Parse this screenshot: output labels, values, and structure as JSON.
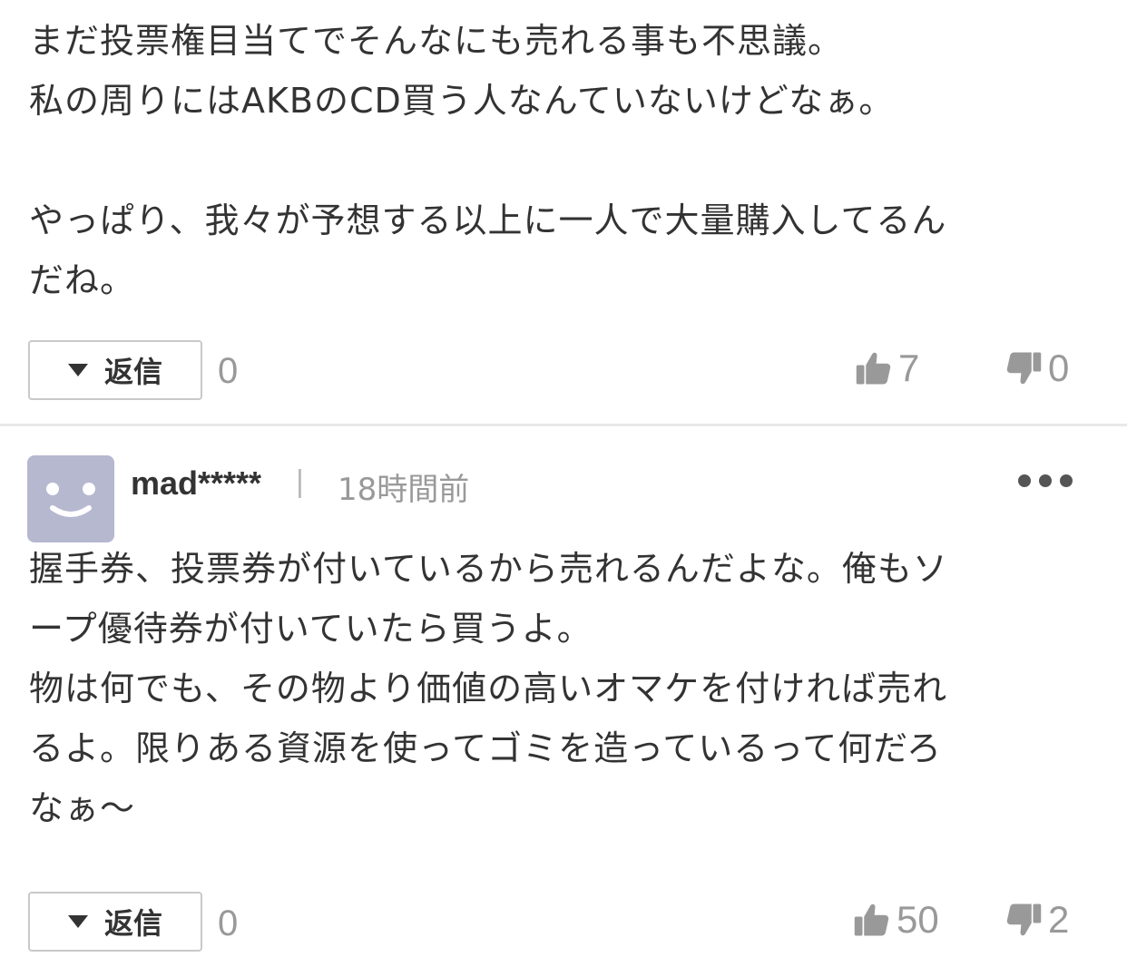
{
  "comments": [
    {
      "body": "まだ投票権目当てでそんなにも売れる事も不思議。\n私の周りにはAKBのCD買う人なんていないけどなぁ。\n\nやっぱり、我々が予想する以上に一人で大量購入してるん\nだね。",
      "reply_label": "返信",
      "reply_count": "0",
      "likes": "7",
      "dislikes": "0"
    },
    {
      "username": "mad*****",
      "separator": "|",
      "timestamp": "18時間前",
      "body": "握手券、投票券が付いているから売れるんだよな。俺もソ\nープ優待券が付いていたら買うよ。\n物は何でも、その物より価値の高いオマケを付ければ売れ\nるよ。限りある資源を使ってゴミを造っているって何だろ\nなぁ～",
      "reply_label": "返信",
      "reply_count": "0",
      "likes": "50",
      "dislikes": "2"
    }
  ],
  "icons": {
    "reply_toggle": "triangle-down-icon",
    "like": "thumbs-up-icon",
    "dislike": "thumbs-down-icon",
    "avatar": "smiley-avatar-icon",
    "menu": "more-dots-icon"
  },
  "colors": {
    "text": "#333333",
    "muted": "#999999",
    "avatar_bg": "#b5b8cf",
    "border": "#c9c9c9",
    "divider": "#e8e8e8"
  }
}
